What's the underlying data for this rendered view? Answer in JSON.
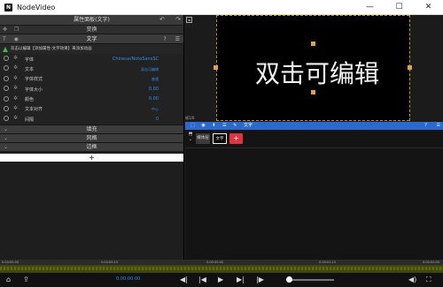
{
  "window": {
    "app_title": "NodeVideo",
    "logo_glyph": "N",
    "minimize_glyph": "—",
    "maximize_glyph": "☐",
    "close_glyph": "✕"
  },
  "panel": {
    "header_title": "属性面板(文字)",
    "undo_glyph": "↶",
    "redo_glyph": "↷",
    "transform_label": "变换",
    "text_section_label": "文字",
    "help_glyph": "?",
    "menu_glyph": "☰",
    "notice": "双击以编辑【添加属性-文字效果】来添加动画",
    "properties": [
      {
        "name": "字体",
        "value": "Chinese/NotoSansSC"
      },
      {
        "name": "文本",
        "value": "双击可编辑"
      },
      {
        "name": "字体样式",
        "value": "普通"
      },
      {
        "name": "字体大小",
        "value": "0.00"
      },
      {
        "name": "颜色",
        "value": "0.00"
      },
      {
        "name": "文本对齐",
        "value": "中心"
      },
      {
        "name": "间隔",
        "value": "0"
      }
    ],
    "subsections": [
      "填充",
      "风格",
      "边框"
    ],
    "add_glyph": "+"
  },
  "preview": {
    "caption": "双击可编辑",
    "frame_label": "帧1/0"
  },
  "track_toolbar": {
    "label": "文字",
    "tool_left": "⬚",
    "tool_eye": "◉",
    "tool_up": "⬆",
    "tool_list": "☰",
    "tool_text": "✎"
  },
  "tracks": {
    "layer_a": "媒体层",
    "layer_b": "文字",
    "add_glyph": "+"
  },
  "timeline": {
    "ruler_labels": [
      "0:00:00:00",
      "0:00:00:15",
      "0:00:00:00",
      "0:00:01:15",
      "0:00:00:00"
    ]
  },
  "bottom": {
    "time": "0:00:00:00",
    "home_glyph": "⌂",
    "share_glyph": "⇪",
    "prev_mark_glyph": "◀|",
    "prev_frame_glyph": "|◀",
    "play_glyph": "▶",
    "next_frame_glyph": "▶|",
    "next_mark_glyph": "|▶",
    "volume_glyph": "◀)",
    "fullscreen_glyph": "⛶"
  }
}
